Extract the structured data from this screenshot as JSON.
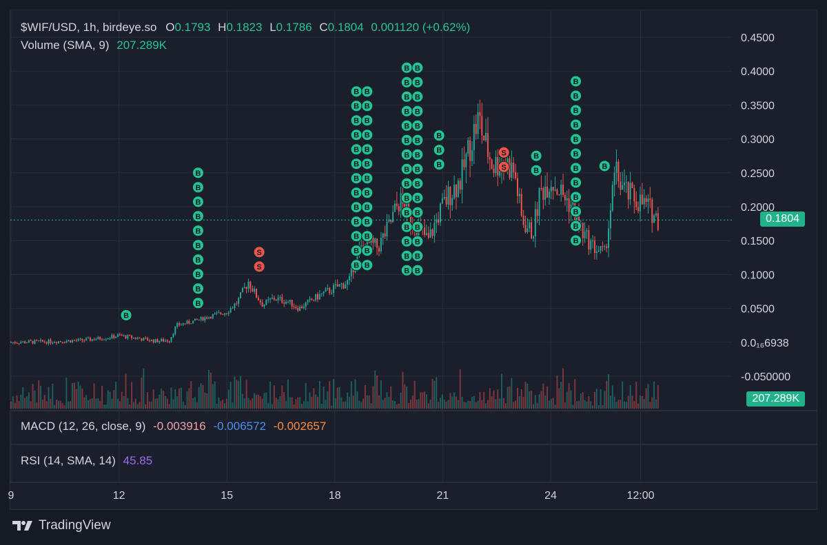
{
  "legend": {
    "symbol": "$WIF/USD, 1h, birdeye.so",
    "o_label": "O",
    "o_val": "0.1793",
    "h_label": "H",
    "h_val": "0.1823",
    "l_label": "L",
    "l_val": "0.1786",
    "c_label": "C",
    "c_val": "0.1804",
    "change": "0.001120 (+0.62%)",
    "volume_label": "Volume (SMA, 9)",
    "volume_val": "207.289K"
  },
  "macd": {
    "label": "MACD (12, 26, close, 9)",
    "v1": "-0.003916",
    "v2": "-0.006572",
    "v3": "-0.002657"
  },
  "rsi": {
    "label": "RSI (14, SMA, 14)",
    "value": "45.85"
  },
  "price_tag": "0.1804",
  "volume_tag": "207.289K",
  "footer": {
    "brand": "TradingView"
  },
  "colors": {
    "up": "#26a69a",
    "down": "#ef5350",
    "bg": "#1b1f2b",
    "grid": "#2a2e39",
    "marker_b": "#26c39a",
    "marker_s": "#ef5350"
  },
  "chart_data": {
    "type": "candlestick",
    "title": "$WIF/USD, 1h, birdeye.so",
    "y_ticks": [
      "0.4500",
      "0.4000",
      "0.3500",
      "0.3000",
      "0.2500",
      "0.2000",
      "0.1500",
      "0.1000",
      "0.0500",
      "0.0₁₆6938",
      "-0.050000"
    ],
    "y_tick_values": [
      0.45,
      0.4,
      0.35,
      0.3,
      0.25,
      0.2,
      0.15,
      0.1,
      0.05,
      0.0,
      -0.05
    ],
    "x_ticks": [
      "9",
      "12",
      "15",
      "18",
      "21",
      "24",
      "12:00"
    ],
    "x_tick_days": [
      9,
      12,
      15,
      18,
      21,
      24,
      26.5
    ],
    "ylim": [
      -0.05,
      0.45
    ],
    "xlim": [
      9,
      29
    ],
    "last_price": 0.1804,
    "close_series": {
      "days": [
        9,
        10,
        11,
        11.7,
        12,
        12.5,
        13,
        13.4,
        13.6,
        14,
        14.5,
        15,
        15.3,
        15.6,
        15.8,
        16,
        16.3,
        16.7,
        17,
        17.3,
        17.6,
        18,
        18.4,
        18.6,
        18.9,
        19.2,
        19.5,
        19.8,
        20,
        20.3,
        20.6,
        20.9,
        21.2,
        21.5,
        21.8,
        22,
        22.2,
        22.4,
        22.7,
        23,
        23.2,
        23.5,
        23.7,
        24,
        24.3,
        24.6,
        24.9,
        25.2,
        25.5,
        25.8,
        26.1,
        26.4,
        26.7,
        27
      ],
      "prices": [
        0.0,
        0.001,
        0.003,
        0.007,
        0.01,
        0.006,
        0.002,
        0.003,
        0.025,
        0.03,
        0.038,
        0.045,
        0.06,
        0.09,
        0.07,
        0.055,
        0.065,
        0.06,
        0.05,
        0.06,
        0.07,
        0.08,
        0.09,
        0.13,
        0.145,
        0.14,
        0.17,
        0.21,
        0.19,
        0.17,
        0.15,
        0.19,
        0.22,
        0.24,
        0.3,
        0.33,
        0.29,
        0.26,
        0.27,
        0.25,
        0.18,
        0.16,
        0.22,
        0.24,
        0.22,
        0.2,
        0.16,
        0.14,
        0.13,
        0.25,
        0.22,
        0.21,
        0.2,
        0.18
      ]
    },
    "markers": [
      {
        "type": "B",
        "day": 12.2,
        "count": 1,
        "top_price": 0.04
      },
      {
        "type": "B",
        "day": 14.2,
        "count": 10,
        "top_price": 0.25
      },
      {
        "type": "S",
        "day": 15.9,
        "count": 2,
        "top_price": 0.133
      },
      {
        "type": "B",
        "day": 18.6,
        "count": 13,
        "top_price": 0.37
      },
      {
        "type": "B",
        "day": 18.9,
        "count": 13,
        "top_price": 0.37
      },
      {
        "type": "B",
        "day": 20.0,
        "count": 15,
        "top_price": 0.405
      },
      {
        "type": "B",
        "day": 20.3,
        "count": 15,
        "top_price": 0.405
      },
      {
        "type": "S",
        "day": 22.7,
        "count": 2,
        "top_price": 0.28
      },
      {
        "type": "B",
        "day": 20.9,
        "count": 3,
        "top_price": 0.305
      },
      {
        "type": "B",
        "day": 23.6,
        "count": 2,
        "top_price": 0.275
      },
      {
        "type": "B",
        "day": 24.7,
        "count": 12,
        "top_price": 0.385
      },
      {
        "type": "B",
        "day": 25.5,
        "count": 1,
        "top_price": 0.26
      }
    ]
  }
}
